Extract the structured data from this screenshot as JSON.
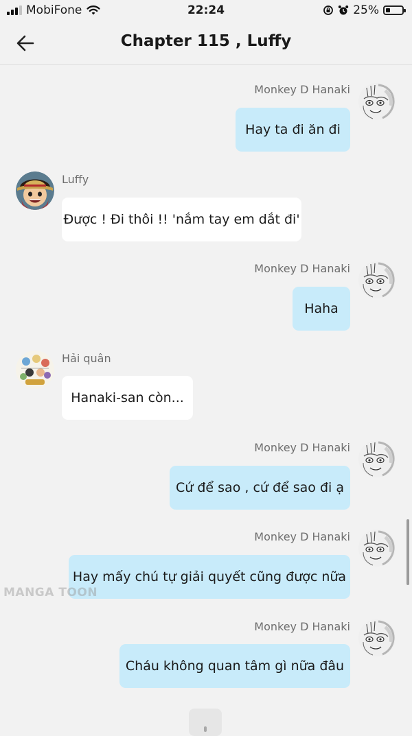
{
  "status_bar": {
    "carrier": "MobiFone",
    "time": "22:24",
    "battery_percent": "25%",
    "battery_level": 0.25,
    "icons": [
      "signal-icon",
      "wifi-icon",
      "orientation-lock-icon",
      "alarm-icon",
      "battery-icon"
    ]
  },
  "header": {
    "title": "Chapter 115 , Luffy",
    "back_icon": "arrow-left-icon"
  },
  "messages": [
    {
      "side": "right",
      "sender": "Monkey D Hanaki",
      "text": "Hay ta đi ăn đi",
      "avatar": "sketch-face-avatar"
    },
    {
      "side": "left",
      "sender": "Luffy",
      "text": "Được ! Đi thôi !! 'nắm tay em dắt đi'",
      "avatar": "luffy-avatar"
    },
    {
      "side": "right",
      "sender": "Monkey D Hanaki",
      "text": "Haha",
      "avatar": "sketch-face-avatar"
    },
    {
      "side": "left",
      "sender": "Hải quân",
      "text": "Hanaki-san còn...",
      "avatar": "group-avatar"
    },
    {
      "side": "right",
      "sender": "Monkey D Hanaki",
      "text": "Cứ để sao , cứ để sao đi ạ",
      "avatar": "sketch-face-avatar"
    },
    {
      "side": "right",
      "sender": "Monkey D Hanaki",
      "text": "Hay mấy chú tự giải quyết cũng được nữa",
      "avatar": "sketch-face-avatar"
    },
    {
      "side": "right",
      "sender": "Monkey D Hanaki",
      "text": "Cháu không quan tâm gì nữa đâu",
      "avatar": "sketch-face-avatar"
    }
  ],
  "watermark": "MANGA TOON",
  "colors": {
    "background": "#f2f2f2",
    "my_bubble": "#c8ebfa",
    "their_bubble": "#ffffff",
    "sender_name": "#6e6e6e"
  }
}
